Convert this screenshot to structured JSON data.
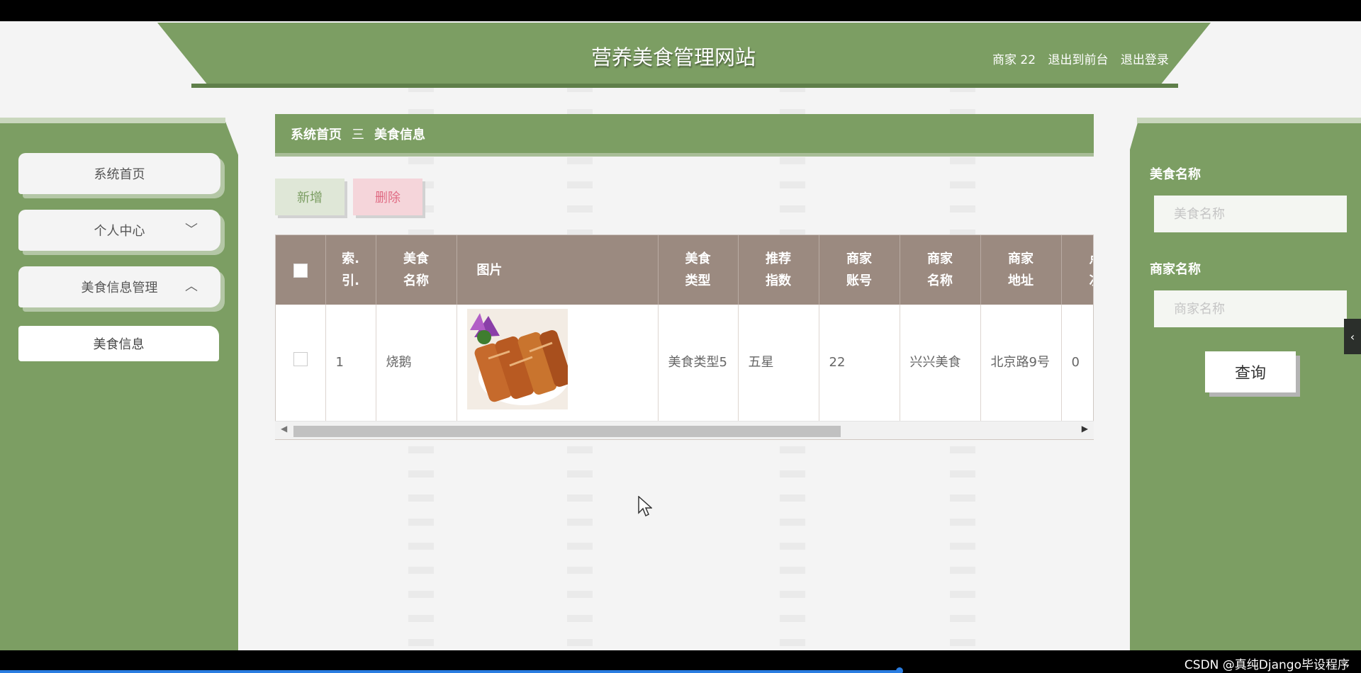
{
  "header": {
    "title": "营养美食管理网站",
    "user": "商家 22",
    "back_to_front": "退出到前台",
    "logout": "退出登录"
  },
  "sidebar": {
    "items": [
      {
        "label": "系统首页",
        "chevron": ""
      },
      {
        "label": "个人中心",
        "chevron": "﹀"
      },
      {
        "label": "美食信息管理",
        "chevron": "︿"
      }
    ],
    "sub_item": "美食信息"
  },
  "breadcrumb": {
    "home": "系统首页",
    "separator": "三",
    "current": "美食信息"
  },
  "toolbar": {
    "add_label": "新增",
    "delete_label": "删除"
  },
  "table": {
    "headers": {
      "index_1": "索.",
      "index_2": "引.",
      "name_1": "美食",
      "name_2": "名称",
      "image": "图片",
      "type_1": "美食",
      "type_2": "类型",
      "rec_1": "推荐",
      "rec_2": "指数",
      "acct_1": "商家",
      "acct_2": "账号",
      "mname_1": "商家",
      "mname_2": "名称",
      "addr_1": "商家",
      "addr_2": "地址",
      "clicks_1": "点",
      "clicks_2": "次"
    },
    "rows": [
      {
        "index": "1",
        "name": "烧鹅",
        "type": "美食类型5",
        "recommend": "五星",
        "merchant_account": "22",
        "merchant_name": "兴兴美食",
        "merchant_address": "北京路9号",
        "clicks": "0"
      }
    ]
  },
  "search": {
    "food_name_label": "美食名称",
    "food_name_placeholder": "美食名称",
    "merchant_name_label": "商家名称",
    "merchant_name_placeholder": "商家名称",
    "query_label": "查询"
  },
  "footer": {
    "credit": "CSDN @真纯Django毕设程序"
  },
  "colors": {
    "primary_green": "#7c9e63",
    "table_header": "#9b8a80",
    "add_button_bg": "#dfe7d7",
    "delete_button_bg": "#f5d5da"
  }
}
